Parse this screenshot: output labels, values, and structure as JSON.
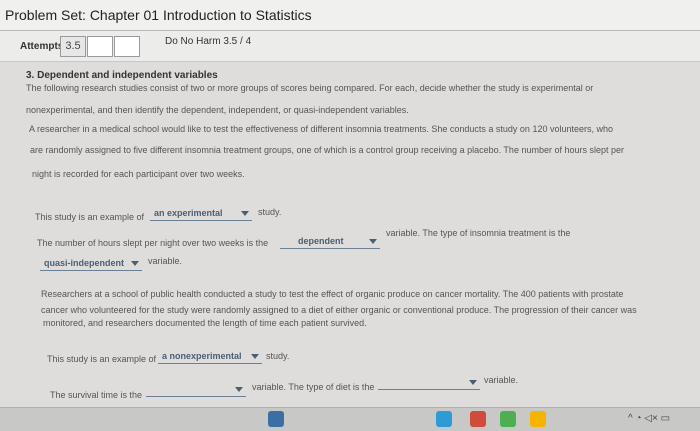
{
  "title": "Problem Set: Chapter 01 Introduction to Statistics",
  "attempts": {
    "label": "Attempts",
    "score": "3.5",
    "do_no_harm": "Do No Harm 3.5 / 4"
  },
  "question": {
    "heading": "3. Dependent and independent variables",
    "intro_line1": "The following research studies consist of two or more groups of scores being compared. For each, decide whether the study is experimental or",
    "intro_line2": "nonexperimental, and then identify the dependent, independent, or quasi-independent variables."
  },
  "study1": {
    "line1": "A researcher in a medical school would like to test the effectiveness of different insomnia treatments. She conducts a study on 120 volunteers, who",
    "line2": "are randomly assigned to five different insomnia treatment groups, one of which is a control group receiving a placebo. The number of hours slept per",
    "line3": "night is recorded for each participant over two weeks.",
    "q1_prefix": "This study is an example of",
    "q1_value": "an experimental",
    "q1_suffix": "study.",
    "q2_prefix": "The number of hours slept per night over two weeks is the",
    "q2_value1": "dependent",
    "q2_mid": "variable. The type of insomnia treatment is the",
    "q2_value2": "quasi-independent",
    "q2_suffix": "variable."
  },
  "study2": {
    "line1": "Researchers at a school of public health conducted a study to test the effect of organic produce on cancer mortality. The 400 patients with prostate",
    "line2": "cancer who volunteered for the study were randomly assigned to a diet of either organic or conventional produce. The progression of their cancer was",
    "line3": "monitored, and researchers documented the length of time each patient survived.",
    "q1_prefix": "This study is an example of",
    "q1_value": "a nonexperimental",
    "q1_suffix": "study.",
    "q2_prefix": "The survival time is the",
    "q2_value1": "",
    "q2_mid": "variable. The type of diet is the",
    "q2_value2": "",
    "q2_suffix": "variable."
  },
  "taskbar": {
    "colors": [
      "#3a6ea5",
      "#2e9bd6",
      "#d14b3c",
      "#4caf50",
      "#f4b400"
    ],
    "icons": [
      "files-icon",
      "store-icon",
      "mail-icon",
      "chat-icon",
      "photos-icon"
    ]
  }
}
